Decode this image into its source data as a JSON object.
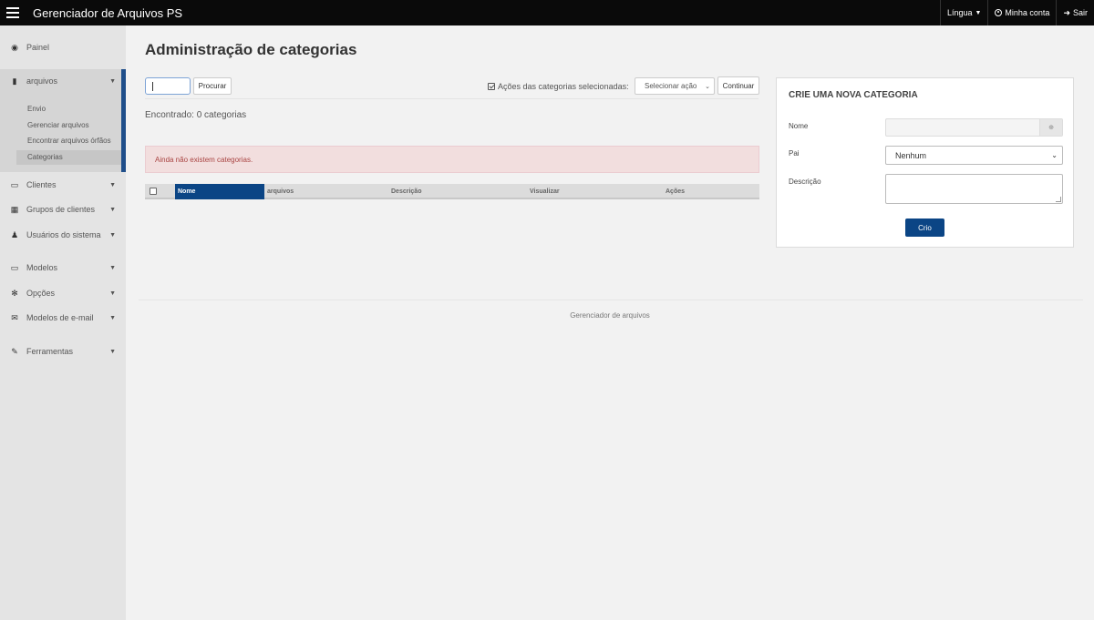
{
  "app": {
    "title": "Gerenciador de Arquivos PS",
    "nav_right": {
      "language": "Língua",
      "my_account": "Minha conta",
      "logout": "Sair"
    }
  },
  "sidebar": {
    "dashboard": "Painel",
    "files": "arquivos",
    "files_sub": [
      "Envio",
      "Gerenciar arquivos",
      "Encontrar arquivos órfãos",
      "Categorias"
    ],
    "clients": "Clientes",
    "client_groups": "Grupos de clientes",
    "system_users": "Usuários do sistema",
    "templates": "Modelos",
    "options": "Opções",
    "email_templates": "Modelos de e-mail",
    "tools": "Ferramentas"
  },
  "main": {
    "page_title": "Administração de categorias",
    "search_value": "",
    "search_button": "Procurar",
    "actions_label": "Ações das categorias selecionadas:",
    "select_action": "Selecionar ação",
    "continue_button": "Continuar",
    "found_text": "Encontrado: 0 categorias",
    "alert_text": "Ainda não existem categorias.",
    "table_headers": [
      "Nome",
      "arquivos",
      "Descrição",
      "Visualizar",
      "Ações"
    ]
  },
  "panel": {
    "title": "CRIE UMA NOVA CATEGORIA",
    "name_label": "Nome",
    "parent_label": "Pai",
    "parent_value": "Nenhum",
    "description_label": "Descrição",
    "create_button": "Crio"
  },
  "footer": {
    "text": "Gerenciador de arquivos"
  },
  "colors": {
    "topbar": "#0a0a0a",
    "accent": "#0b4585",
    "alert_bg": "#f2dede",
    "alert_text": "#a94442"
  }
}
